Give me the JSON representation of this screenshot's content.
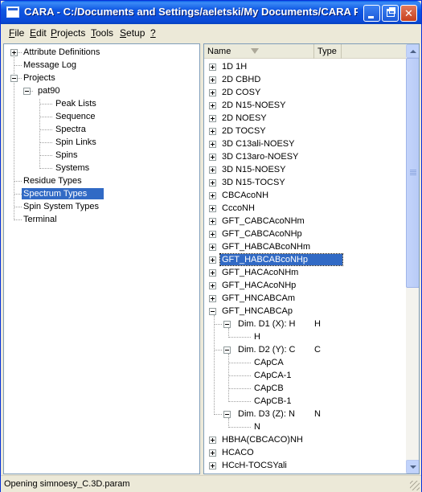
{
  "window": {
    "title": "CARA - C:/Documents and Settings/aeletski/My Documents/CARA P..."
  },
  "menu": [
    {
      "accel": "F",
      "rest": "ile"
    },
    {
      "accel": "E",
      "rest": "dit"
    },
    {
      "accel": "P",
      "rest": "rojects"
    },
    {
      "accel": "T",
      "rest": "ools"
    },
    {
      "accel": "S",
      "rest": "etup"
    },
    {
      "accel": "?",
      "rest": ""
    }
  ],
  "left_tree": {
    "items": [
      {
        "label": "Attribute Definitions",
        "level": 0,
        "expander": "plus"
      },
      {
        "label": "Message Log",
        "level": 0,
        "expander": "none"
      },
      {
        "label": "Projects",
        "level": 0,
        "expander": "minus"
      },
      {
        "label": "pat90",
        "level": 1,
        "expander": "minus"
      },
      {
        "label": "Peak Lists",
        "level": 2,
        "expander": "none"
      },
      {
        "label": "Sequence",
        "level": 2,
        "expander": "none"
      },
      {
        "label": "Spectra",
        "level": 2,
        "expander": "none"
      },
      {
        "label": "Spin Links",
        "level": 2,
        "expander": "none"
      },
      {
        "label": "Spins",
        "level": 2,
        "expander": "none"
      },
      {
        "label": "Systems",
        "level": 2,
        "expander": "none"
      },
      {
        "label": "Residue Types",
        "level": 0,
        "expander": "none"
      },
      {
        "label": "Spectrum Types",
        "level": 0,
        "expander": "none",
        "selected": true
      },
      {
        "label": "Spin System Types",
        "level": 0,
        "expander": "none"
      },
      {
        "label": "Terminal",
        "level": 0,
        "expander": "none"
      }
    ]
  },
  "right_table": {
    "columns": [
      "Name",
      "Type"
    ],
    "rows": [
      {
        "name": " 1D 1H",
        "type": "",
        "level": 0,
        "expander": "plus"
      },
      {
        "name": "2D CBHD",
        "type": "",
        "level": 0,
        "expander": "plus"
      },
      {
        "name": "2D COSY",
        "type": "",
        "level": 0,
        "expander": "plus"
      },
      {
        "name": "2D N15-NOESY",
        "type": "",
        "level": 0,
        "expander": "plus"
      },
      {
        "name": "2D NOESY",
        "type": "",
        "level": 0,
        "expander": "plus"
      },
      {
        "name": "2D TOCSY",
        "type": "",
        "level": 0,
        "expander": "plus"
      },
      {
        "name": "3D C13ali-NOESY",
        "type": "",
        "level": 0,
        "expander": "plus"
      },
      {
        "name": "3D C13aro-NOESY",
        "type": "",
        "level": 0,
        "expander": "plus"
      },
      {
        "name": "3D N15-NOESY",
        "type": "",
        "level": 0,
        "expander": "plus"
      },
      {
        "name": "3D N15-TOCSY",
        "type": "",
        "level": 0,
        "expander": "plus"
      },
      {
        "name": "CBCAcoNH",
        "type": "",
        "level": 0,
        "expander": "plus"
      },
      {
        "name": "CccoNH",
        "type": "",
        "level": 0,
        "expander": "plus"
      },
      {
        "name": "GFT_CABCAcoNHm",
        "type": "",
        "level": 0,
        "expander": "plus"
      },
      {
        "name": "GFT_CABCAcoNHp",
        "type": "",
        "level": 0,
        "expander": "plus"
      },
      {
        "name": "GFT_HABCABcoNHm",
        "type": "",
        "level": 0,
        "expander": "plus"
      },
      {
        "name": "GFT_HABCABcoNHp",
        "type": "",
        "level": 0,
        "expander": "plus",
        "selected": true
      },
      {
        "name": "GFT_HACAcoNHm",
        "type": "",
        "level": 0,
        "expander": "plus"
      },
      {
        "name": "GFT_HACAcoNHp",
        "type": "",
        "level": 0,
        "expander": "plus"
      },
      {
        "name": "GFT_HNCABCAm",
        "type": "",
        "level": 0,
        "expander": "plus"
      },
      {
        "name": "GFT_HNCABCAp",
        "type": "",
        "level": 0,
        "expander": "minus"
      },
      {
        "name": "Dim. D1 (X): H",
        "type": "H",
        "level": 1,
        "expander": "minus"
      },
      {
        "name": "H",
        "type": "",
        "level": 2,
        "expander": "none"
      },
      {
        "name": "Dim. D2 (Y): C",
        "type": "C",
        "level": 1,
        "expander": "minus"
      },
      {
        "name": "CApCA",
        "type": "",
        "level": 2,
        "expander": "none"
      },
      {
        "name": "CApCA-1",
        "type": "",
        "level": 2,
        "expander": "none"
      },
      {
        "name": "CApCB",
        "type": "",
        "level": 2,
        "expander": "none"
      },
      {
        "name": "CApCB-1",
        "type": "",
        "level": 2,
        "expander": "none"
      },
      {
        "name": "Dim. D3 (Z): N",
        "type": "N",
        "level": 1,
        "expander": "minus"
      },
      {
        "name": "N",
        "type": "",
        "level": 2,
        "expander": "none"
      },
      {
        "name": "HBHA(CBCACO)NH",
        "type": "",
        "level": 0,
        "expander": "plus"
      },
      {
        "name": "HCACO",
        "type": "",
        "level": 0,
        "expander": "plus"
      },
      {
        "name": "HCcH-TOCSYali",
        "type": "",
        "level": 0,
        "expander": "plus"
      }
    ]
  },
  "status": {
    "text": "Opening simnoesy_C.3D.param"
  },
  "colors": {
    "selection": "#316ac5",
    "titlebar": "#0a49d6",
    "background": "#ece9d8"
  }
}
